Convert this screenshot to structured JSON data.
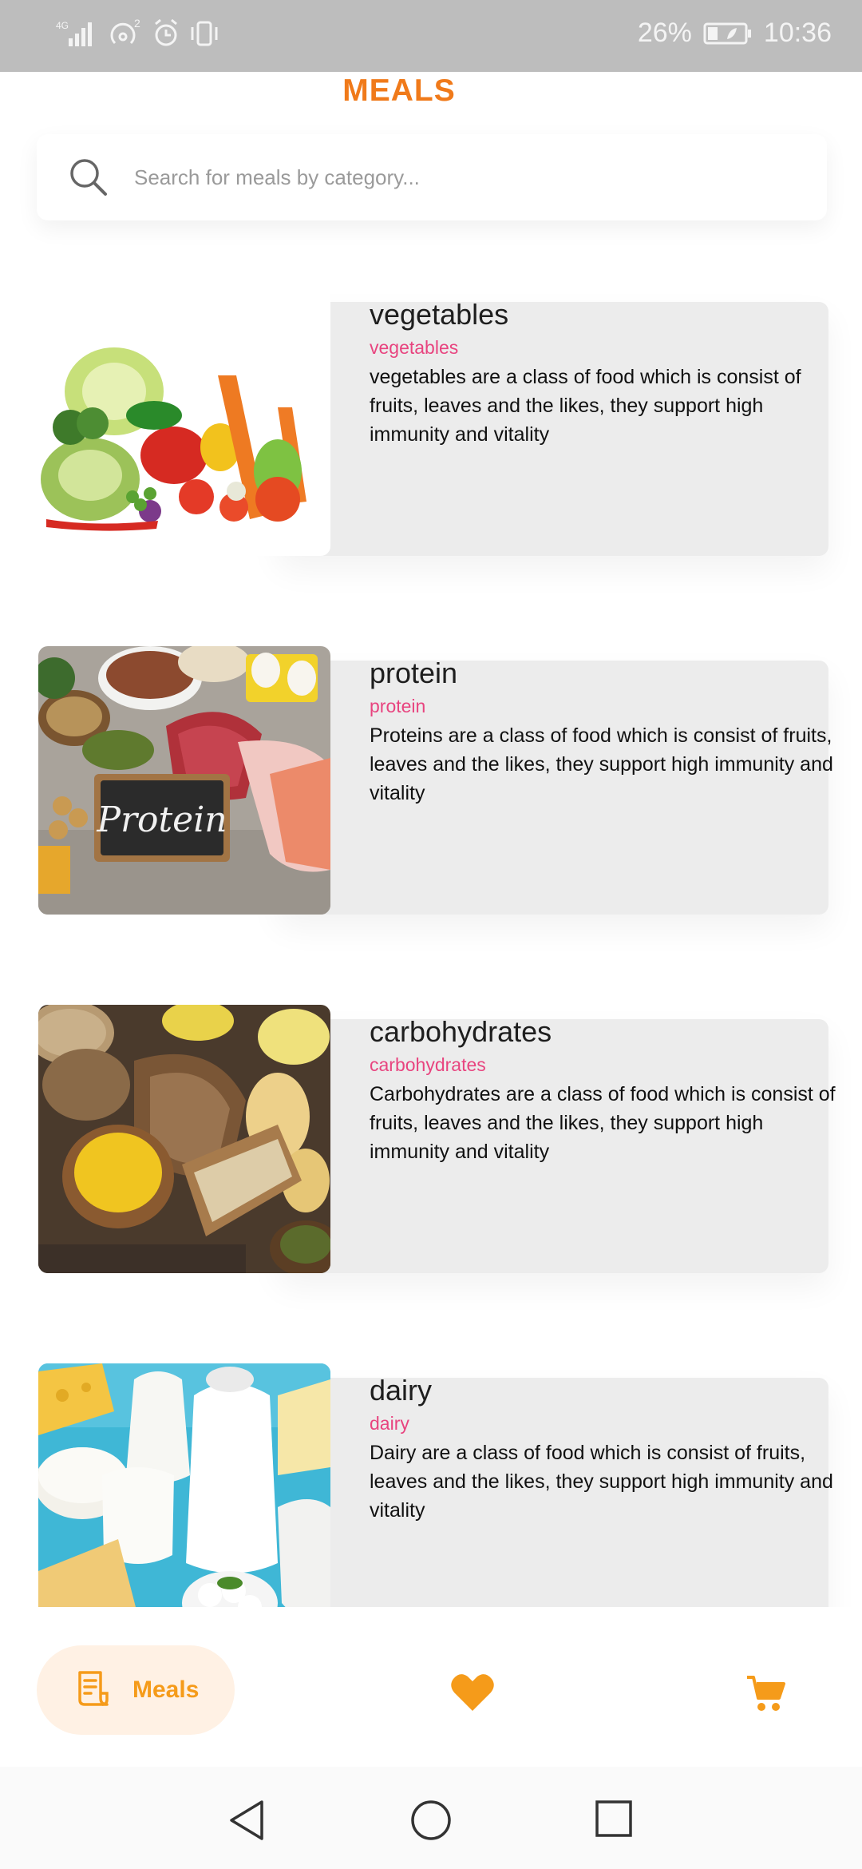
{
  "status_bar": {
    "network": "4G",
    "battery": "26%",
    "time": "10:36"
  },
  "header": {
    "title": "MEALS"
  },
  "search": {
    "placeholder": "Search for meals by category..."
  },
  "meals": [
    {
      "title": "vegetables",
      "category": "vegetables",
      "description": "vegetables are a class of  food which is consist of fruits, leaves and the likes, they support high immunity and vitality"
    },
    {
      "title": "protein",
      "category": "protein",
      "description": "Proteins are a class of  food which is consist of fruits, leaves and the likes, they support high immunity and vitality",
      "image_label": "Protein"
    },
    {
      "title": "carbohydrates",
      "category": "carbohydrates",
      "description": "Carbohydrates are a class of  food which is consist of fruits, leaves and the likes, they support high immunity and vitality"
    },
    {
      "title": "dairy",
      "category": "dairy",
      "description": "Dairy are a class of  food which is consist of fruits, leaves and the likes, they support high immunity and vitality"
    }
  ],
  "bottom_nav": {
    "items": [
      {
        "label": "Meals",
        "icon": "receipt-icon",
        "active": true
      },
      {
        "label": "",
        "icon": "heart-icon",
        "active": false
      },
      {
        "label": "",
        "icon": "cart-icon",
        "active": false
      }
    ]
  },
  "colors": {
    "accent": "#f07a1a",
    "category_text": "#e8447f",
    "nav_active_bg": "#fff1e4",
    "nav_icon": "#f59b1a",
    "card_bg": "#ececec"
  }
}
